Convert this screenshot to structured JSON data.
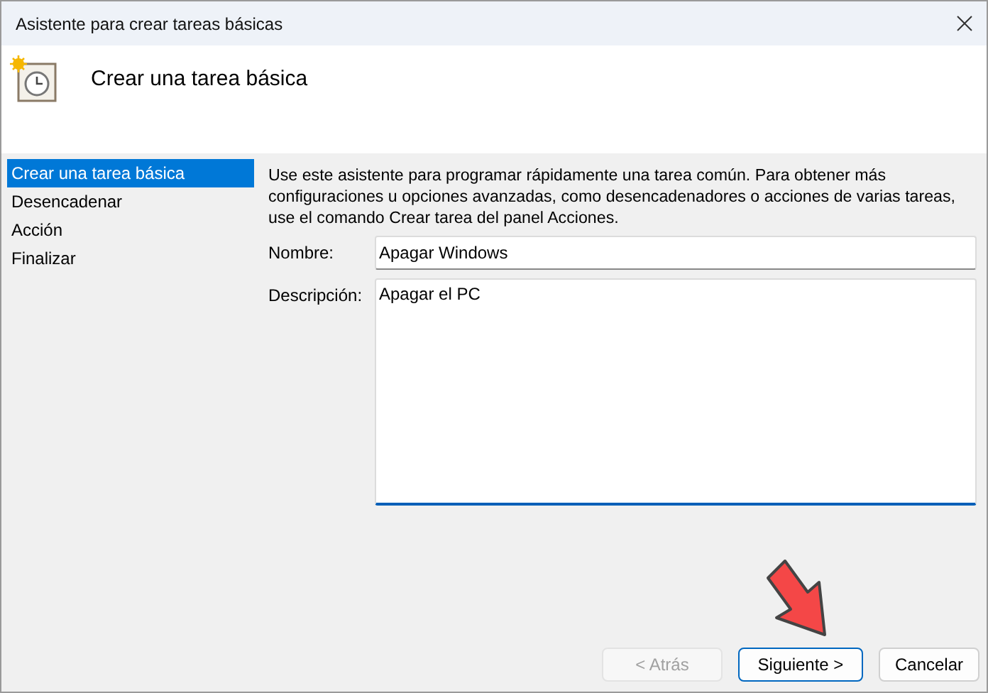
{
  "window": {
    "title": "Asistente para crear tareas básicas",
    "heading": "Crear una tarea básica"
  },
  "sidebar": {
    "items": [
      {
        "label": "Crear una tarea básica",
        "selected": true
      },
      {
        "label": "Desencadenar",
        "selected": false
      },
      {
        "label": "Acción",
        "selected": false
      },
      {
        "label": "Finalizar",
        "selected": false
      }
    ]
  },
  "intro": "Use este asistente para programar rápidamente una tarea común. Para obtener más configuraciones u opciones avanzadas, como desencadenadores o acciones de varias tareas, use el comando Crear tarea del panel Acciones.",
  "fields": [
    {
      "label": "Nombre:",
      "value": "Apagar Windows",
      "kind": "line"
    },
    {
      "label": "Descripción:",
      "value": "Apagar el PC",
      "kind": "area",
      "focused": true
    }
  ],
  "buttons": [
    {
      "label": "< Atrás",
      "disabled": true,
      "default": false
    },
    {
      "label": "Siguiente >",
      "disabled": false,
      "default": true
    },
    {
      "label": "Cancelar",
      "disabled": false,
      "default": false
    }
  ]
}
